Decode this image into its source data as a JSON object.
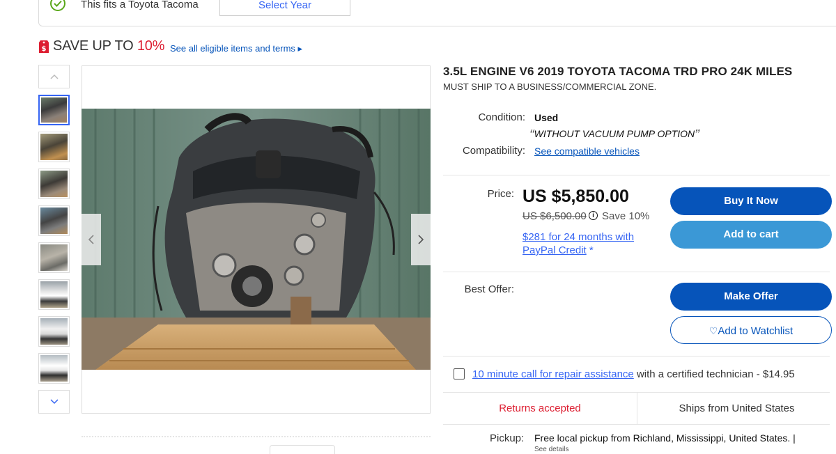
{
  "fitment": {
    "text": "This fits a Toyota Tacoma",
    "select_label": "Select Year"
  },
  "promo": {
    "prefix": "SAVE UP TO ",
    "percent": "10%",
    "link": "See all eligible items and terms ▸"
  },
  "gallery": {
    "thumbnail_count": 8,
    "active_index": 0
  },
  "listing": {
    "title": "3.5L ENGINE V6 2019 TOYOTA TACOMA TRD PRO 24K MILES",
    "subtitle": "MUST SHIP TO A BUSINESS/COMMERCIAL ZONE.",
    "condition_label": "Condition:",
    "condition_value": "Used",
    "condition_note": "WITHOUT VACUUM PUMP OPTION",
    "compat_label": "Compatibility:",
    "compat_link": "See compatible vehicles",
    "price_label": "Price:",
    "price": "US $5,850.00",
    "was_price": "US $6,500.00",
    "save_text": "Save 10%",
    "credit_link": "$281 for 24 months with PayPal Credit",
    "credit_star": "*",
    "buy_now": "Buy It Now",
    "add_to_cart": "Add to cart",
    "best_offer_label": "Best Offer:",
    "make_offer": "Make Offer",
    "watchlist": "Add to Watchlist",
    "repair_link": "10 minute call for repair assistance",
    "repair_suffix": " with a certified technician - $14.95",
    "returns": "Returns accepted",
    "ships": "Ships from United States",
    "pickup_label": "Pickup:",
    "pickup_value": "Free local pickup from Richland, Mississippi, United States. |",
    "see_details": "See details"
  },
  "colors": {
    "primary": "#0654ba",
    "secondary": "#3b98d6",
    "accent_red": "#dd1e31",
    "check_green": "#5ba71b"
  }
}
